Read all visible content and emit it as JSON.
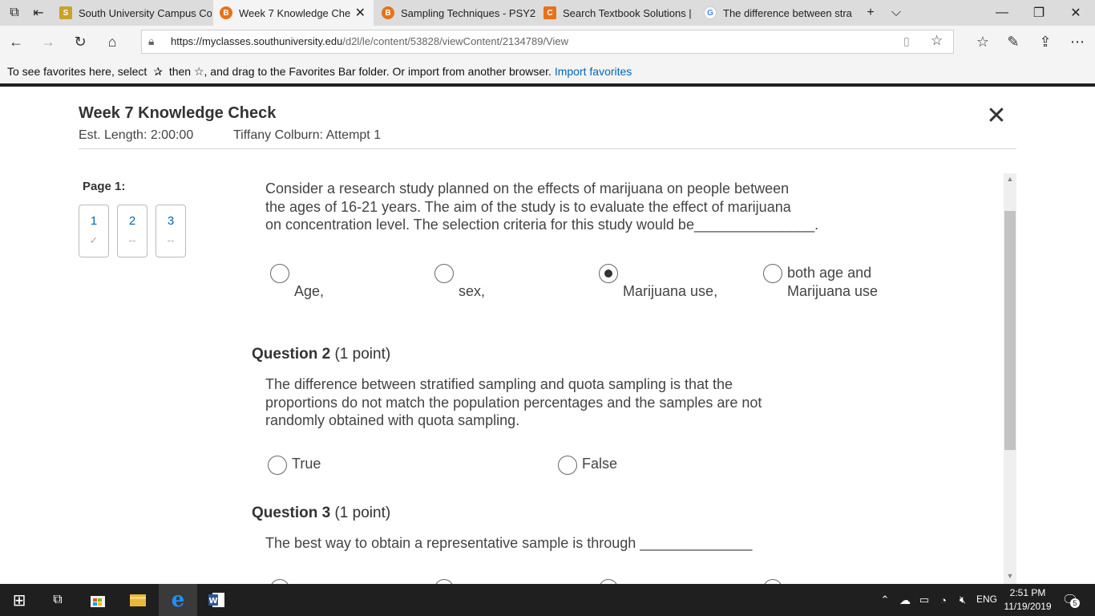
{
  "browser": {
    "tabs": [
      {
        "title": "South University Campus Co",
        "favicon": "S",
        "favicon_color": "#c9a227"
      },
      {
        "title": "Week 7 Knowledge Che",
        "favicon": "B",
        "favicon_color": "#e8711a"
      },
      {
        "title": "Sampling Techniques - PSY2",
        "favicon": "B",
        "favicon_color": "#e8711a"
      },
      {
        "title": "Search Textbook Solutions |",
        "favicon": "C",
        "favicon_color": "#e8711a"
      },
      {
        "title": "The difference between stra",
        "favicon": "G",
        "favicon_color": "#4285f4"
      }
    ],
    "url_host": "https://myclasses.southuniversity.edu",
    "url_path": "/d2l/le/content/53828/viewContent/2134789/View",
    "favorites_bar": {
      "text_a": "To see favorites here, select",
      "text_b": "then ☆, and drag to the Favorites Bar folder. Or import from another browser.",
      "link": "Import favorites"
    }
  },
  "quiz": {
    "title": "Week 7 Knowledge Check",
    "est_length": "Est. Length: 2:00:00",
    "attempt": "Tiffany Colburn: Attempt 1",
    "page_label": "Page 1:",
    "nav": [
      {
        "num": "1",
        "status": "✓"
      },
      {
        "num": "2",
        "status": "--"
      },
      {
        "num": "3",
        "status": "--"
      }
    ],
    "q1": {
      "lines": [
        "Consider a research study planned on the effects of marijuana on people between",
        "the ages of 16-21 years. The aim of the study is to evaluate the effect of marijuana",
        "on concentration level. The selection criteria for this study would be_______________."
      ],
      "options": [
        "Age,",
        "sex,",
        "Marijuana use,",
        "both age and",
        "Marijuana use"
      ],
      "selected_option": "Marijuana use,"
    },
    "q2": {
      "label": "Question 2",
      "points": "(1 point)",
      "lines": [
        "The difference between stratified sampling and quota sampling is that the",
        "proportions do not match the population percentages and the samples are not",
        "randomly obtained with quota sampling."
      ],
      "options": [
        "True",
        "False"
      ]
    },
    "q3": {
      "label": "Question 3",
      "points": "(1 point)",
      "lines": [
        "The best way to obtain a representative sample is through ______________"
      ]
    }
  },
  "taskbar": {
    "time": "2:51 PM",
    "date": "11/19/2019",
    "lang": "ENG",
    "notif_count": "5"
  }
}
